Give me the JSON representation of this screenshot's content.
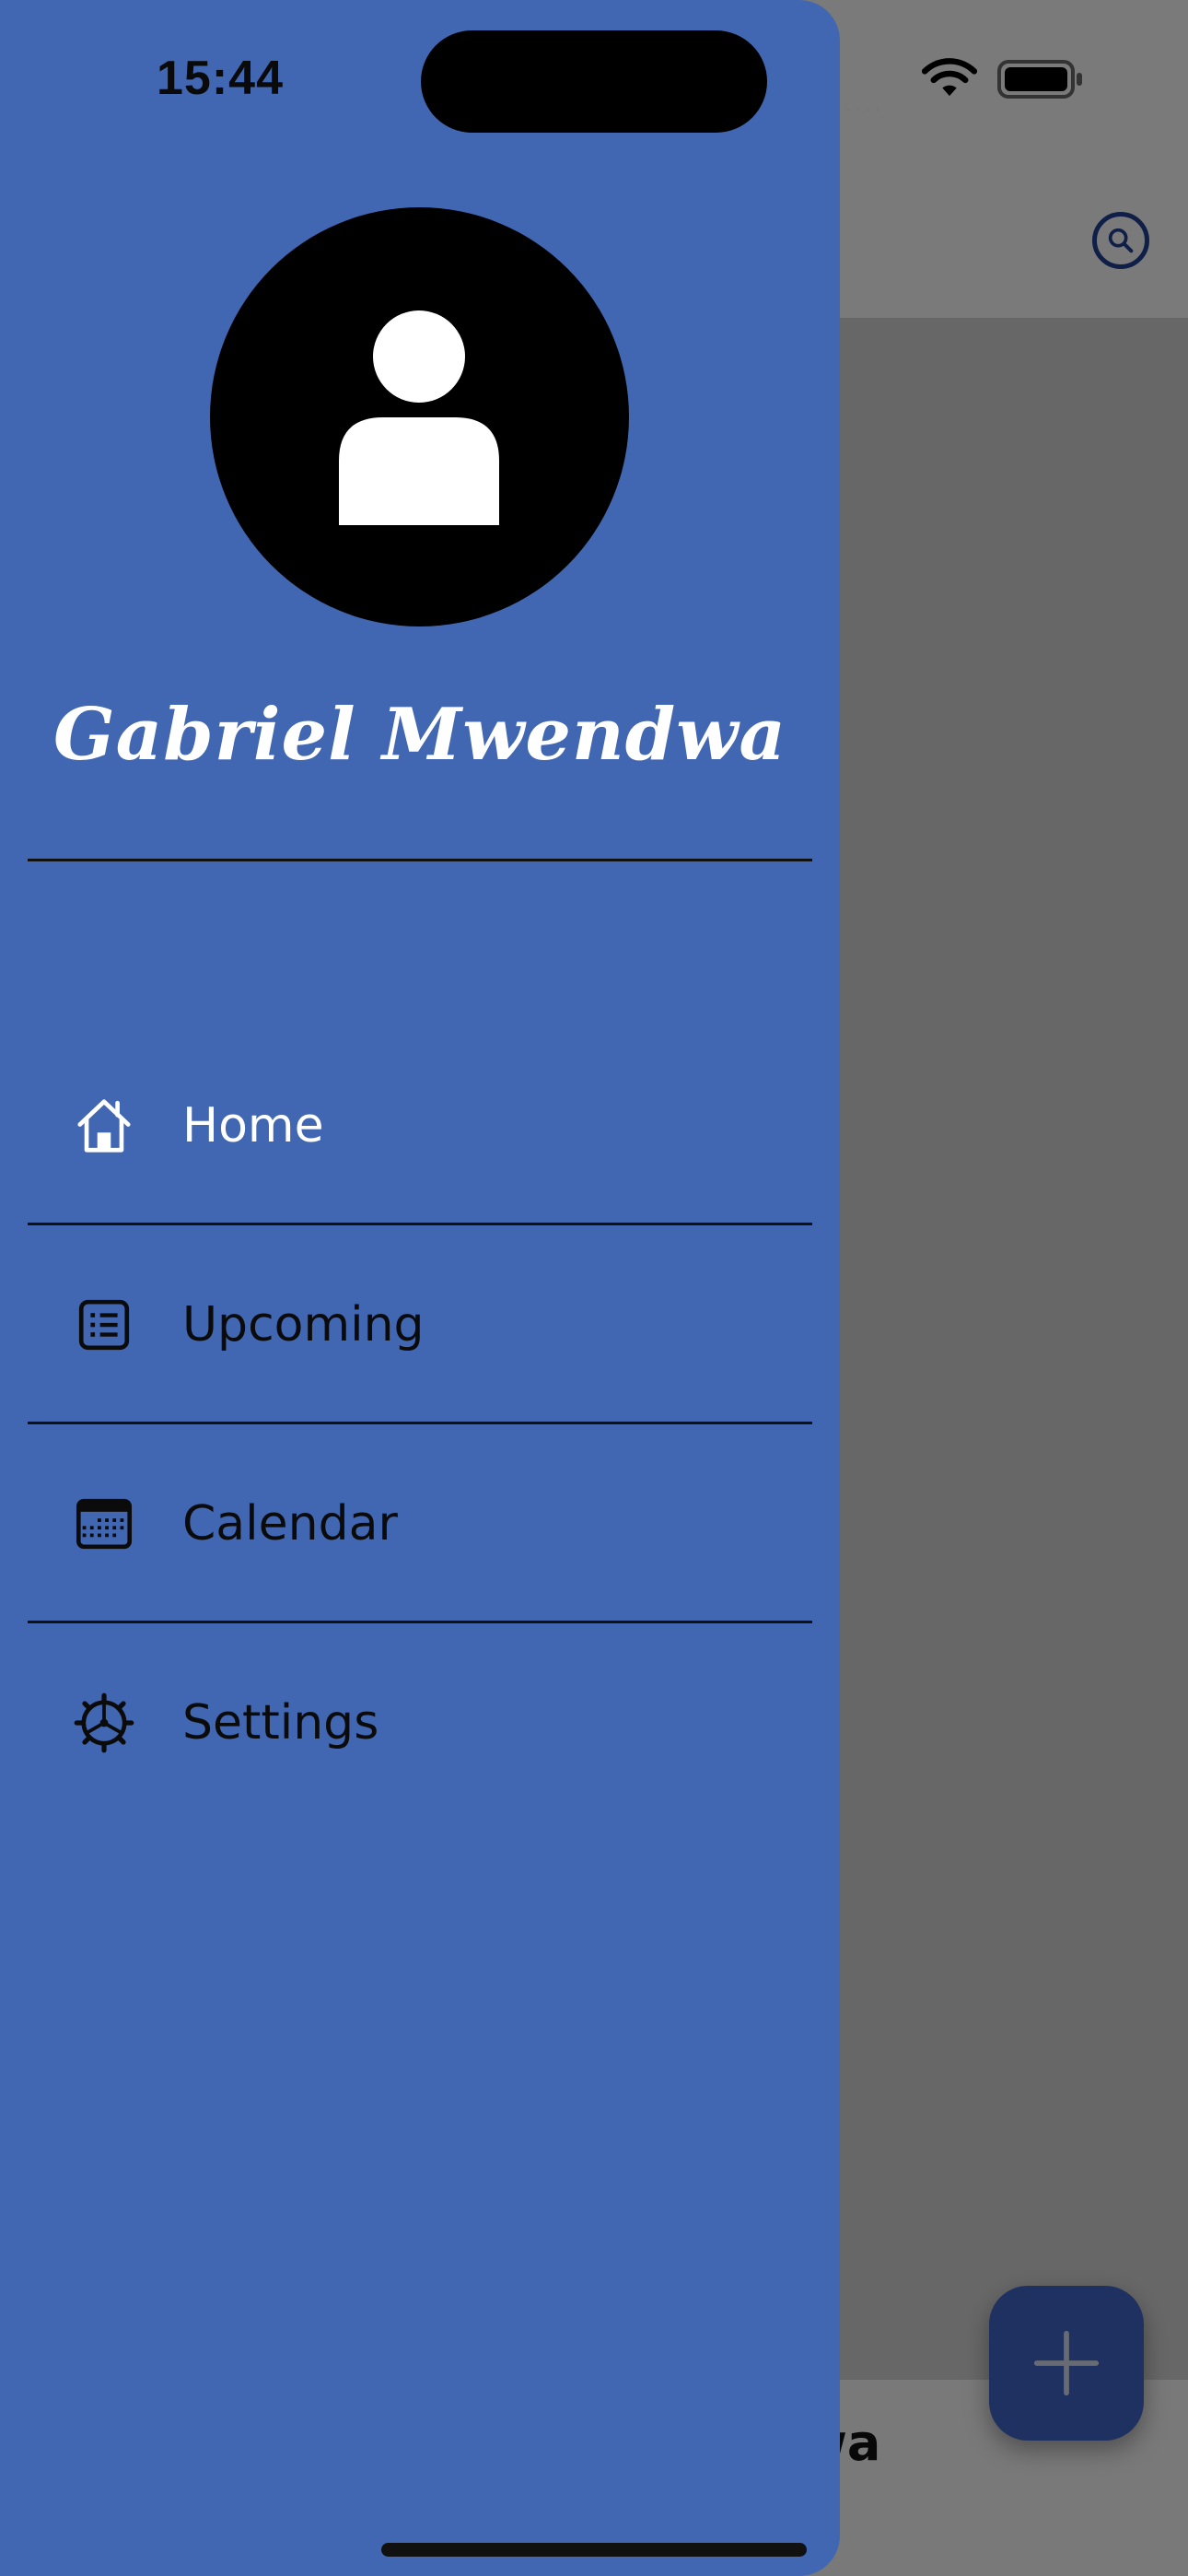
{
  "status_bar": {
    "time": "15:44",
    "signal_dots": "....",
    "wifi_icon": "wifi-icon",
    "battery_icon": "battery-icon"
  },
  "background_app": {
    "search_icon": "search-icon",
    "footer_text_visible": "wa",
    "fab_icon": "plus-icon"
  },
  "drawer": {
    "avatar_icon": "person-icon",
    "user_name": "Gabriel Mwendwa",
    "items": [
      {
        "label": "Home",
        "icon": "home-icon",
        "active": true
      },
      {
        "label": "Upcoming",
        "icon": "list-icon",
        "active": false
      },
      {
        "label": "Calendar",
        "icon": "calendar-icon",
        "active": false
      },
      {
        "label": "Settings",
        "icon": "gear-icon",
        "active": false
      }
    ]
  },
  "colors": {
    "drawer_bg": "#4267b2",
    "active_text": "#ffffff",
    "inactive_text": "#0b0b0b",
    "fab_bg": "#3e63c2",
    "search_accent": "#1f3f8f"
  }
}
